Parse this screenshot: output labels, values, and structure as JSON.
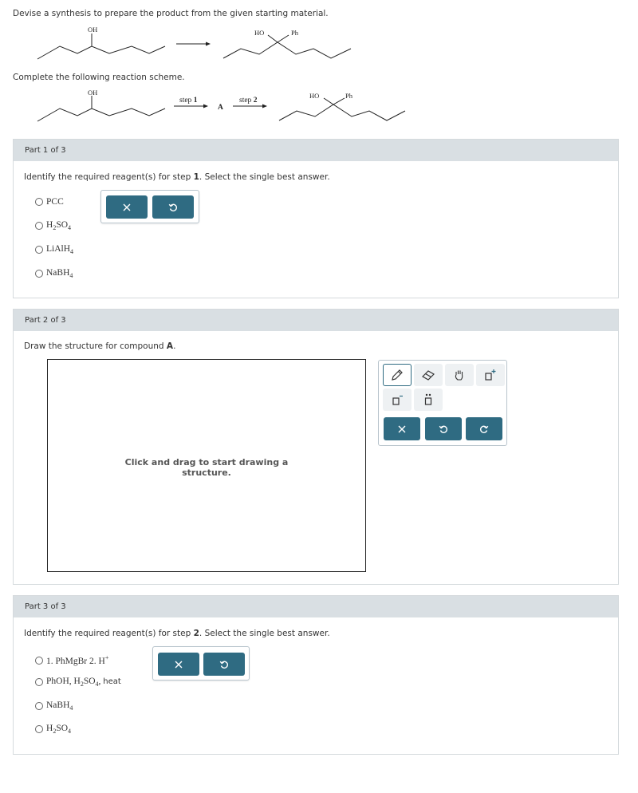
{
  "question": {
    "prompt": "Devise a synthesis to prepare the product from the given starting material.",
    "complete_text": "Complete the following reaction scheme.",
    "labels": {
      "oh": "OH",
      "ho": "HO",
      "ph": "Ph",
      "step1_word": "step",
      "step1_num": "1",
      "step2_word": "step",
      "step2_num": "2",
      "intermediate": "A"
    }
  },
  "part1": {
    "header": "Part 1 of 3",
    "instruction_pre": "Identify the required reagent(s) for step ",
    "instruction_num": "1",
    "instruction_post": ". Select the single best answer.",
    "options": [
      {
        "text": "PCC"
      },
      {
        "main": "H",
        "sub1": "2",
        "mid": "SO",
        "sub2": "4"
      },
      {
        "main": "LiAlH",
        "sub": "4"
      },
      {
        "main": "NaBH",
        "sub": "4"
      }
    ]
  },
  "part2": {
    "header": "Part 2 of 3",
    "instruction_pre": "Draw the structure for compound ",
    "instruction_bold": "A",
    "instruction_post": ".",
    "canvas_hint_line1": "Click and drag to start drawing a",
    "canvas_hint_line2": "structure."
  },
  "part3": {
    "header": "Part 3 of 3",
    "instruction_pre": "Identify the required reagent(s) for step ",
    "instruction_num": "2",
    "instruction_post": ". Select the single best answer.",
    "options": [
      {
        "text": "1. PhMgBr 2. H",
        "sup": "+"
      },
      {
        "pre": "PhOH, H",
        "sub1": "2",
        "mid": "SO",
        "sub2": "4",
        "post": ", ",
        "heat": "heat"
      },
      {
        "main": "NaBH",
        "sub": "4"
      },
      {
        "main": "H",
        "sub1": "2",
        "mid": "SO",
        "sub2": "4"
      }
    ]
  },
  "colors": {
    "accent": "#2f6b82",
    "header_bg": "#d9dfe3",
    "border": "#d5dadd"
  },
  "icons": {
    "clear": "close-icon",
    "undo": "undo-icon",
    "redo": "redo-icon",
    "pencil": "pencil-icon",
    "eraser": "eraser-icon",
    "hand": "hand-icon",
    "positive_charge": "positive-charge-icon",
    "negative_charge": "negative-charge-icon",
    "lone_pair": "lone-pair-icon"
  }
}
